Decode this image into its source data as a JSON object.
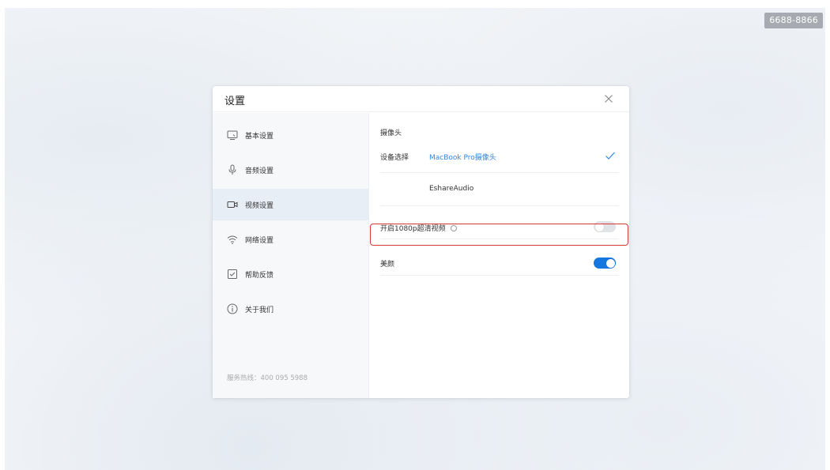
{
  "room_code": "6688-8866",
  "dialog": {
    "title": "设置"
  },
  "sidebar": {
    "items": [
      {
        "label": "基本设置",
        "icon": "monitor-icon"
      },
      {
        "label": "音频设置",
        "icon": "microphone-icon"
      },
      {
        "label": "视频设置",
        "icon": "camera-icon"
      },
      {
        "label": "网络设置",
        "icon": "wifi-icon"
      },
      {
        "label": "帮助反馈",
        "icon": "feedback-icon"
      },
      {
        "label": "关于我们",
        "icon": "info-icon"
      }
    ],
    "active_index": 2,
    "hotline": "服务热线：400 095 5988"
  },
  "video": {
    "section_title": "摄像头",
    "device_label": "设备选择",
    "devices": [
      {
        "name": "MacBook Pro摄像头",
        "selected": true
      },
      {
        "name": "EshareAudio",
        "selected": false
      }
    ],
    "hd_label": "开启1080p超清视频",
    "hd_enabled": false,
    "beauty_label": "美颜",
    "beauty_enabled": true
  },
  "colors": {
    "accent": "#1677e0",
    "link": "#2f87e0",
    "highlight": "#d73636"
  }
}
